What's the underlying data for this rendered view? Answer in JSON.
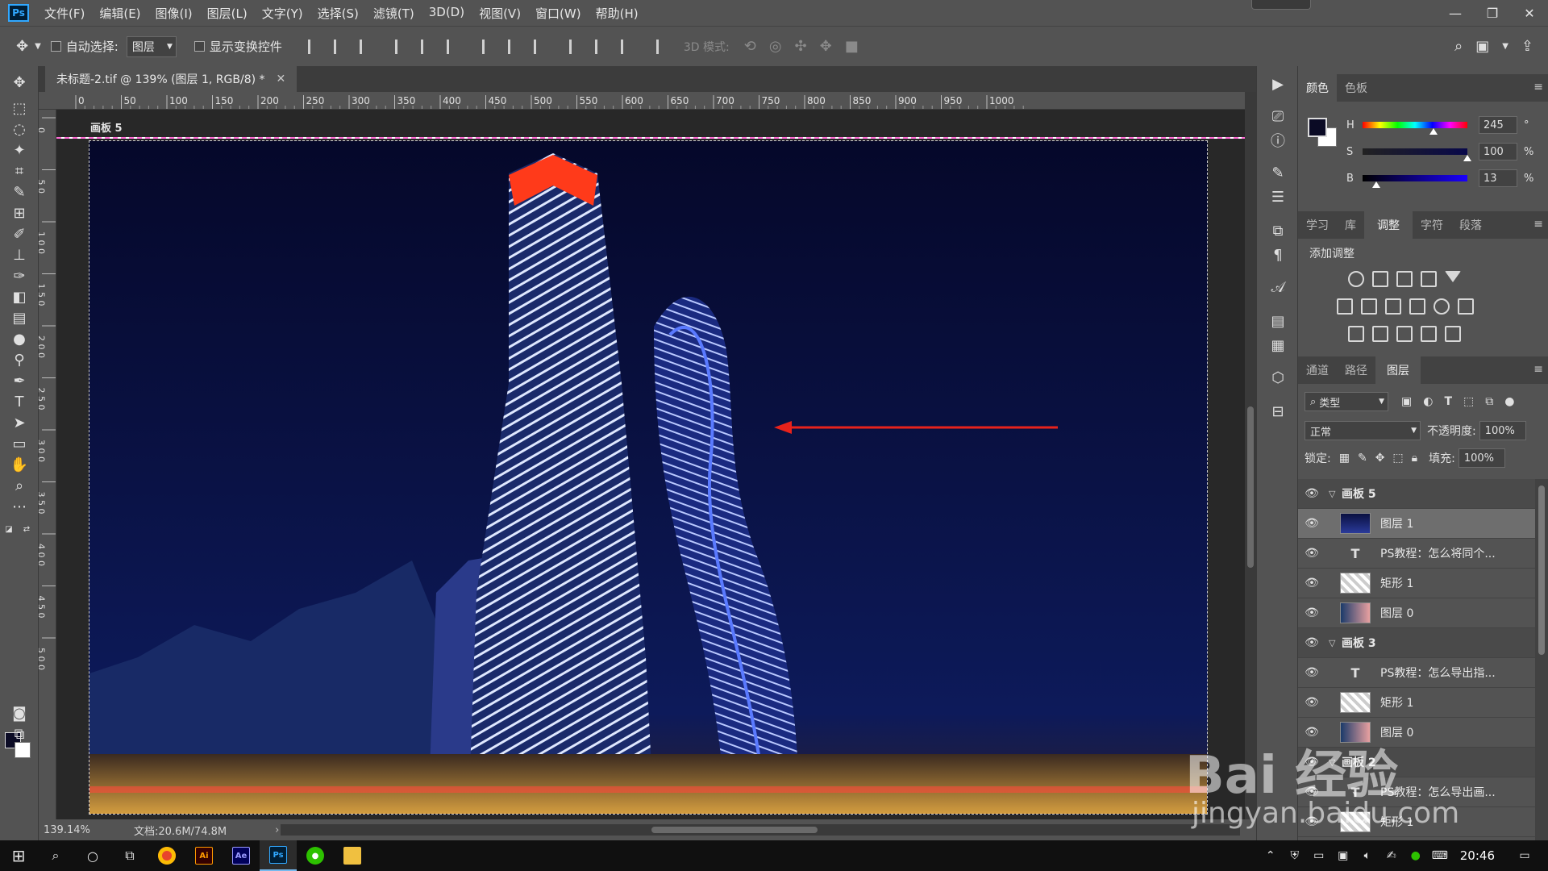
{
  "app": {
    "logo_text": "Ps"
  },
  "menu": [
    "文件(F)",
    "编辑(E)",
    "图像(I)",
    "图层(L)",
    "文字(Y)",
    "选择(S)",
    "滤镜(T)",
    "3D(D)",
    "视图(V)",
    "窗口(W)",
    "帮助(H)"
  ],
  "options_bar": {
    "auto_select_label": "自动选择:",
    "auto_select_value": "图层",
    "show_transform_label": "显示变换控件",
    "mode_3d_label": "3D 模式:"
  },
  "document": {
    "tab_title": "未标题-2.tif @ 139% (图层 1, RGB/8) *",
    "artboard_label": "画板 5"
  },
  "ruler": {
    "h_labels": [
      "0",
      "50",
      "100",
      "150",
      "200",
      "250",
      "300",
      "350",
      "400",
      "450",
      "500",
      "550",
      "600",
      "650",
      "700",
      "750",
      "800",
      "850",
      "900",
      "950",
      "1000"
    ],
    "v_labels": [
      "0",
      "5 0",
      "1 0 0",
      "1 5 0",
      "2 0 0",
      "2 5 0",
      "3 0 0",
      "3 5 0",
      "4 0 0",
      "4 5 0",
      "5 0 0"
    ]
  },
  "status": {
    "zoom": "139.14%",
    "doc_info": "文档:20.6M/74.8M"
  },
  "color_panel": {
    "tabs": [
      "颜色",
      "色板"
    ],
    "active_tab": "颜色",
    "foreground_color": "#0b0b25",
    "background_color": "#ffffff",
    "sliders": [
      {
        "label": "H",
        "value": "245",
        "unit": "°",
        "fraction": 0.68
      },
      {
        "label": "S",
        "value": "100",
        "unit": "%",
        "fraction": 1.0
      },
      {
        "label": "B",
        "value": "13",
        "unit": "%",
        "fraction": 0.13
      }
    ]
  },
  "adjust_panel": {
    "tabs": [
      "学习",
      "库",
      "调整",
      "字符",
      "段落"
    ],
    "active_tab": "调整",
    "add_label": "添加调整"
  },
  "layers_panel": {
    "tabs": [
      "通道",
      "路径",
      "图层"
    ],
    "active_tab": "图层",
    "filter_kind": "类型",
    "blend_mode": "正常",
    "opacity_label": "不透明度:",
    "opacity_value": "100%",
    "lock_label": "锁定:",
    "fill_label": "填充:",
    "fill_value": "100%",
    "layers": [
      {
        "name": "画板 5",
        "kind": "group"
      },
      {
        "name": "图层 1",
        "kind": "image",
        "selected": true
      },
      {
        "name": "PS教程：怎么将同个...",
        "kind": "text"
      },
      {
        "name": "矩形 1",
        "kind": "shape"
      },
      {
        "name": "图层 0",
        "kind": "photo"
      },
      {
        "name": "画板 3",
        "kind": "group"
      },
      {
        "name": "PS教程：怎么导出指...",
        "kind": "text"
      },
      {
        "name": "矩形 1",
        "kind": "shape"
      },
      {
        "name": "图层 0",
        "kind": "photo"
      },
      {
        "name": "画板 2",
        "kind": "group"
      },
      {
        "name": "PS教程：怎么导出画...",
        "kind": "text"
      },
      {
        "name": "矩形 1",
        "kind": "shape"
      }
    ]
  },
  "taskbar": {
    "apps": [
      "Ai",
      "Ae",
      "Ps"
    ],
    "clock": "20:46"
  },
  "watermark": {
    "brand": "Bai 经验",
    "url": "jingyan.baidu.com"
  },
  "colors": {
    "accent_ps": "#31a8ff",
    "arrow": "#e8221b",
    "selection_magenta": "#ff6ad5"
  }
}
